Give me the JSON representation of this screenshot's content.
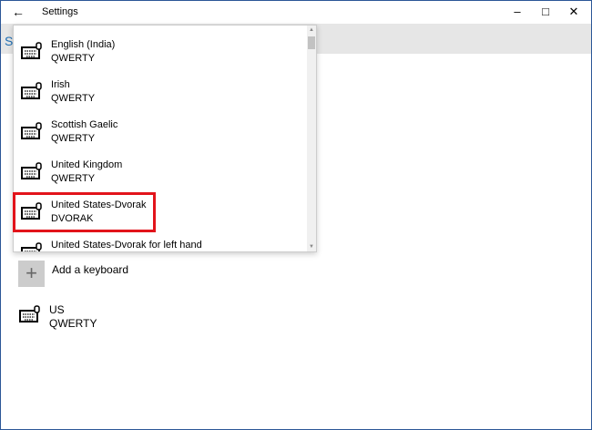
{
  "window": {
    "title": "Settings",
    "page_initial": "S"
  },
  "dropdown": {
    "items": [
      {
        "name": "English (India)",
        "layout": "QWERTY"
      },
      {
        "name": "Irish",
        "layout": "QWERTY"
      },
      {
        "name": "Scottish Gaelic",
        "layout": "QWERTY"
      },
      {
        "name": "United Kingdom",
        "layout": "QWERTY"
      },
      {
        "name": "United States-Dvorak",
        "layout": "DVORAK"
      },
      {
        "name": "United States-Dvorak for left hand",
        "layout": ""
      }
    ]
  },
  "add_keyboard": {
    "label": "Add a keyboard"
  },
  "installed": {
    "name": "US",
    "layout": "QWERTY"
  },
  "colors": {
    "highlight": "#e2141b",
    "accent": "#1e6fb5"
  }
}
